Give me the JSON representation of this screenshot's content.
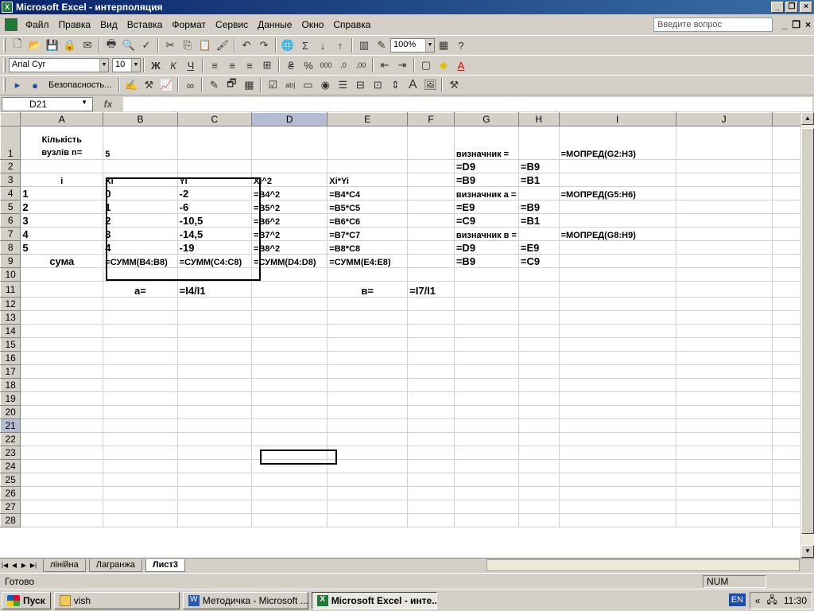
{
  "window": {
    "title": "Microsoft Excel - интерполяция"
  },
  "menu": [
    "Файл",
    "Правка",
    "Вид",
    "Вставка",
    "Формат",
    "Сервис",
    "Данные",
    "Окно",
    "Справка"
  ],
  "ask_placeholder": "Введите вопрос",
  "toolbar": {
    "zoom": "100%",
    "font": "Arial Cyr",
    "size": "10",
    "security": "Безопасность..."
  },
  "namebox": "D21",
  "fx_label": "fx",
  "columns": [
    "A",
    "B",
    "C",
    "D",
    "E",
    "F",
    "G",
    "H",
    "I",
    "J"
  ],
  "cells": {
    "A1": "Кількість",
    "A1b": "вузлів n=",
    "B1": "5",
    "G1": "визначник   =",
    "I1": "=МОПРЕД(G2:H3)",
    "G2": "=D9",
    "H2": "=B9",
    "A3": "i",
    "B3": "Xi",
    "C3": "Yi",
    "D3": "Xi^2",
    "E3": "Xi*Yi",
    "G3": "=B9",
    "H3": "=B1",
    "A4": "1",
    "B4": "0",
    "C4": "-2",
    "D4": "=B4^2",
    "E4": "=B4*C4",
    "G4": "визначник а  =",
    "I4": "=МОПРЕД(G5:H6)",
    "A5": "2",
    "B5": "1",
    "C5": "-6",
    "D5": "=B5^2",
    "E5": "=B5*C5",
    "G5": "=E9",
    "H5": "=B9",
    "A6": "3",
    "B6": "2",
    "C6": "-10,5",
    "D6": "=B6^2",
    "E6": "=B6*C6",
    "G6": "=C9",
    "H6": "=B1",
    "A7": "4",
    "B7": "3",
    "C7": "-14,5",
    "D7": "=B7^2",
    "E7": "=B7*C7",
    "G7": "визначник в  =",
    "I7": "=МОПРЕД(G8:H9)",
    "A8": "5",
    "B8": "4",
    "C8": "-19",
    "D8": "=B8^2",
    "E8": "=B8*C8",
    "G8": "=D9",
    "H8": "=E9",
    "A9": "сума",
    "B9": "=СУММ(B4:B8)",
    "C9": "=СУММ(C4:C8)",
    "D9": "=СУММ(D4:D8)",
    "E9": "=СУММ(E4:E8)",
    "G9": "=B9",
    "H9": "=C9",
    "B11": "а=",
    "C11": "=I4/I1",
    "E11": "в=",
    "F11": "=I7/I1"
  },
  "sheets": [
    "лінійна",
    "Лагранжа",
    "Лист3"
  ],
  "status": {
    "ready": "Готово",
    "num": "NUM"
  },
  "taskbar": {
    "start": "Пуск",
    "tasks": [
      "vish",
      "Методичка - Microsoft ...",
      "Microsoft Excel - инте..."
    ],
    "lang": "EN",
    "time": "11:30"
  }
}
